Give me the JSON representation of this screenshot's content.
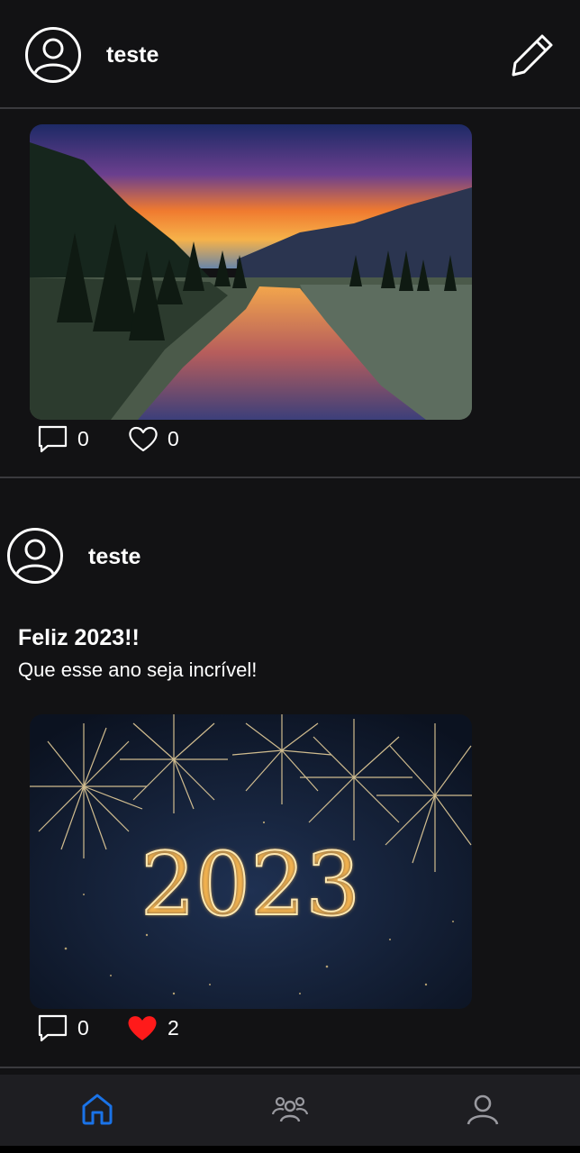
{
  "header": {
    "username": "teste"
  },
  "posts": [
    {
      "image": "landscape-sunset-river-photo",
      "comments": "0",
      "likes": "0",
      "liked": false
    },
    {
      "username": "teste",
      "title": "Feliz 2023!!",
      "body": "Que esse ano seja incrível!",
      "image": "fireworks-2023-photo",
      "image_text": "2023",
      "comments": "0",
      "likes": "2",
      "liked": true
    }
  ],
  "nav": {
    "items": [
      "home-icon",
      "groups-icon",
      "profile-icon"
    ],
    "active": "home-icon"
  },
  "colors": {
    "background": "#121214",
    "accent": "#1a73e8",
    "like": "#ff1a1a",
    "divider": "#3a3a3e"
  }
}
